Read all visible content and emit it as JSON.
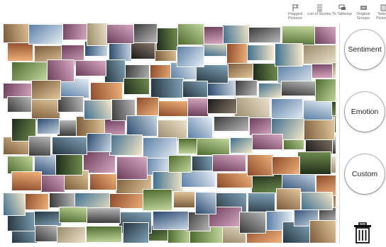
{
  "toolbar": {
    "flagged": {
      "label": "Flagged Pictures",
      "icon": "flag-icon"
    },
    "list_of_stories": {
      "label": "List of Stories",
      "icon": "list-icon"
    },
    "to_tabletop": {
      "label": "To Tabletop",
      "icon": "chat-icon"
    },
    "original_groups": {
      "label": "Original Groups",
      "icon": "group-icon"
    },
    "select_pictures": {
      "label": "Select Pictures",
      "icon": "select-icon"
    }
  },
  "sidebar": {
    "sentiment_label": "Sentiment",
    "emotion_label": "Emotion",
    "custom_label": "Custom",
    "trash_icon": "trash-icon"
  },
  "colors": {
    "background": "#ffffff",
    "sidebar_border": "#d6d6d6",
    "toolbar_text": "#666666"
  }
}
